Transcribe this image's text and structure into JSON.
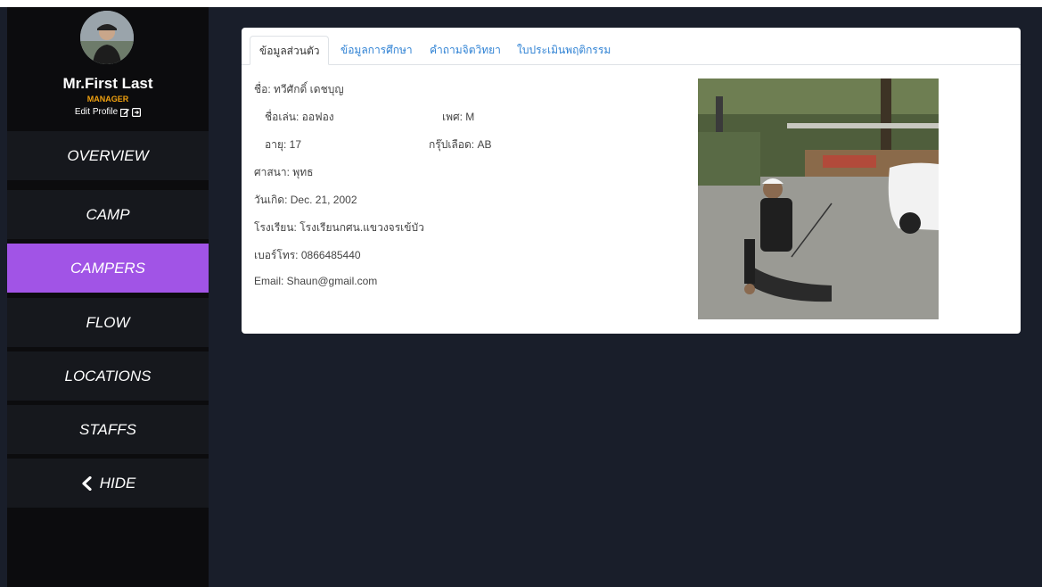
{
  "profile": {
    "name": "Mr.First Last",
    "role": "MANAGER",
    "edit_label": "Edit Profile",
    "edit_icon": "edit-icon",
    "logout_icon": "logout-icon"
  },
  "nav": [
    {
      "label": "OVERVIEW"
    },
    {
      "label": "CAMP"
    },
    {
      "label": "CAMPERS",
      "active": true
    },
    {
      "label": "FLOW"
    },
    {
      "label": "LOCATIONS"
    },
    {
      "label": "STAFFS"
    },
    {
      "label": "HIDE",
      "icon": "chevron-left-icon"
    }
  ],
  "colors": {
    "background": "#191e2a",
    "sidebar": "#0c0c0e",
    "nav_item": "#16181d",
    "active": "#a154e6",
    "role": "#f0a10f",
    "tab_link": "#2f82d4"
  },
  "tabs": [
    {
      "label": "ข้อมูลส่วนตัว",
      "active": true
    },
    {
      "label": "ข้อมูลการศึกษา"
    },
    {
      "label": "คำถามจิตวิทยา"
    },
    {
      "label": "ใบประเมินพฤติกรรม"
    }
  ],
  "camper": {
    "name": "ชื่อ: ทวีศักดิ์ เดชบุญ",
    "nickname": "ชื่อเล่น: ออฟอง",
    "gender": "เพศ: M",
    "age": "อายุ: 17",
    "blood": "กรุ๊ปเลือด: AB",
    "religion": "ศาสนา: พุทธ",
    "birthday": "วันเกิด: Dec. 21, 2002",
    "school": "โรงเรียน: โรงเรียนกศน.แขวงจรเข้บัว",
    "phone": "เบอร์โทร: 0866485440",
    "email": "Email: Shaun@gmail.com"
  }
}
